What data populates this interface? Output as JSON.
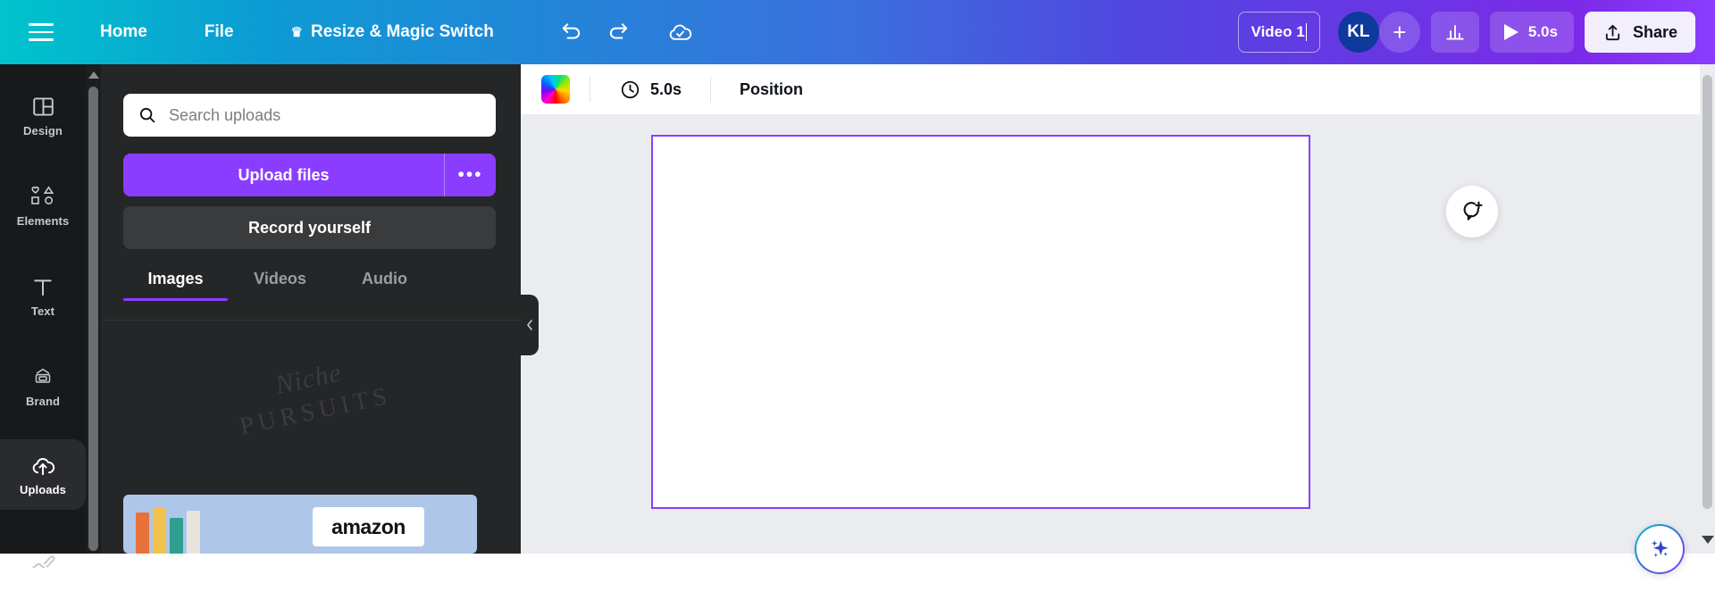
{
  "topbar": {
    "menu_icon": "hamburger-icon",
    "home": "Home",
    "file": "File",
    "resize": "Resize & Magic Switch",
    "resize_badge": "crown-icon",
    "undo": "undo-icon",
    "redo": "redo-icon",
    "cloud_status": "cloud-check-icon",
    "title_value": "Video 1",
    "avatar_initials": "KL",
    "add_people": "+",
    "insights_icon": "bar-chart-icon",
    "play_icon": "play-icon",
    "duration": "5.0s",
    "share_label": "Share",
    "share_icon": "upload-share-icon",
    "gradient_from": "#00c4cc",
    "gradient_to": "#8b3dff"
  },
  "rail": {
    "items": [
      {
        "label": "Design",
        "icon": "layout-icon",
        "active": false
      },
      {
        "label": "Elements",
        "icon": "shapes-icon",
        "active": false
      },
      {
        "label": "Text",
        "icon": "text-t-icon",
        "active": false
      },
      {
        "label": "Brand",
        "icon": "brand-co-icon",
        "active": false
      },
      {
        "label": "Uploads",
        "icon": "cloud-upload-icon",
        "active": true
      },
      {
        "label": "",
        "icon": "draw-pencil-icon",
        "active": false
      }
    ]
  },
  "panel": {
    "search": {
      "placeholder": "Search uploads",
      "value": "",
      "icon": "search-icon"
    },
    "upload_button": "Upload files",
    "upload_more": "•••",
    "record_button": "Record yourself",
    "tabs": [
      {
        "label": "Images",
        "active": true
      },
      {
        "label": "Videos",
        "active": false
      },
      {
        "label": "Audio",
        "active": false
      }
    ],
    "watermark": {
      "line1": "Niche",
      "line2": "PURSUITS"
    },
    "upload_card": {
      "brand_text": "amazon"
    },
    "accent": "#8b3dff",
    "collapse_icon": "chevron-left-icon"
  },
  "editor": {
    "context_bar": {
      "color_swatch": "rainbow-color-swatch",
      "clock_icon": "clock-icon",
      "duration": "5.0s",
      "position": "Position"
    },
    "comment_icon": "add-comment-icon",
    "magic_icon": "magic-sparkle-icon",
    "selection_color": "#8b3dff",
    "canvas_bg": "#ebecf0"
  }
}
